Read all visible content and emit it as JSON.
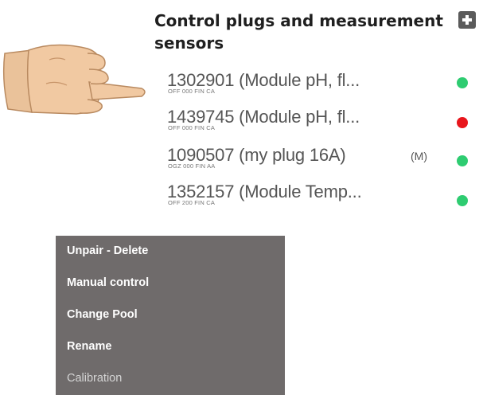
{
  "header": {
    "title": "Control plugs and measurement sensors"
  },
  "devices": [
    {
      "name": "1302901 (Module pH, fl...",
      "code": "OFF 000 FIN CA",
      "mode": "",
      "status_color": "#2ecc71",
      "has_wifi": true
    },
    {
      "name": "1439745 (Module pH, fl...",
      "code": "OFF 000 FIN CA",
      "mode": "",
      "status_color": "#e8161c",
      "has_wifi": false
    },
    {
      "name": "1090507 (my plug 16A)",
      "code": "OGZ 000 FIN AA",
      "mode": "(M)",
      "status_color": "#2ecc71",
      "has_wifi": true
    },
    {
      "name": "1352157 (Module Temp...",
      "code": "OFF 200 FIN CA",
      "mode": "",
      "status_color": "#2ecc71",
      "has_wifi": true
    }
  ],
  "context_menu": {
    "items": [
      {
        "label": "Unpair - Delete",
        "enabled": true
      },
      {
        "label": "Manual control",
        "enabled": true
      },
      {
        "label": "Change Pool",
        "enabled": true
      },
      {
        "label": "Rename",
        "enabled": true
      },
      {
        "label": "Calibration",
        "enabled": false
      }
    ]
  },
  "colors": {
    "menu_background": "#6f6b6b",
    "status_ok": "#2ecc71",
    "status_error": "#e8161c",
    "wifi": "#f4dc5a"
  }
}
